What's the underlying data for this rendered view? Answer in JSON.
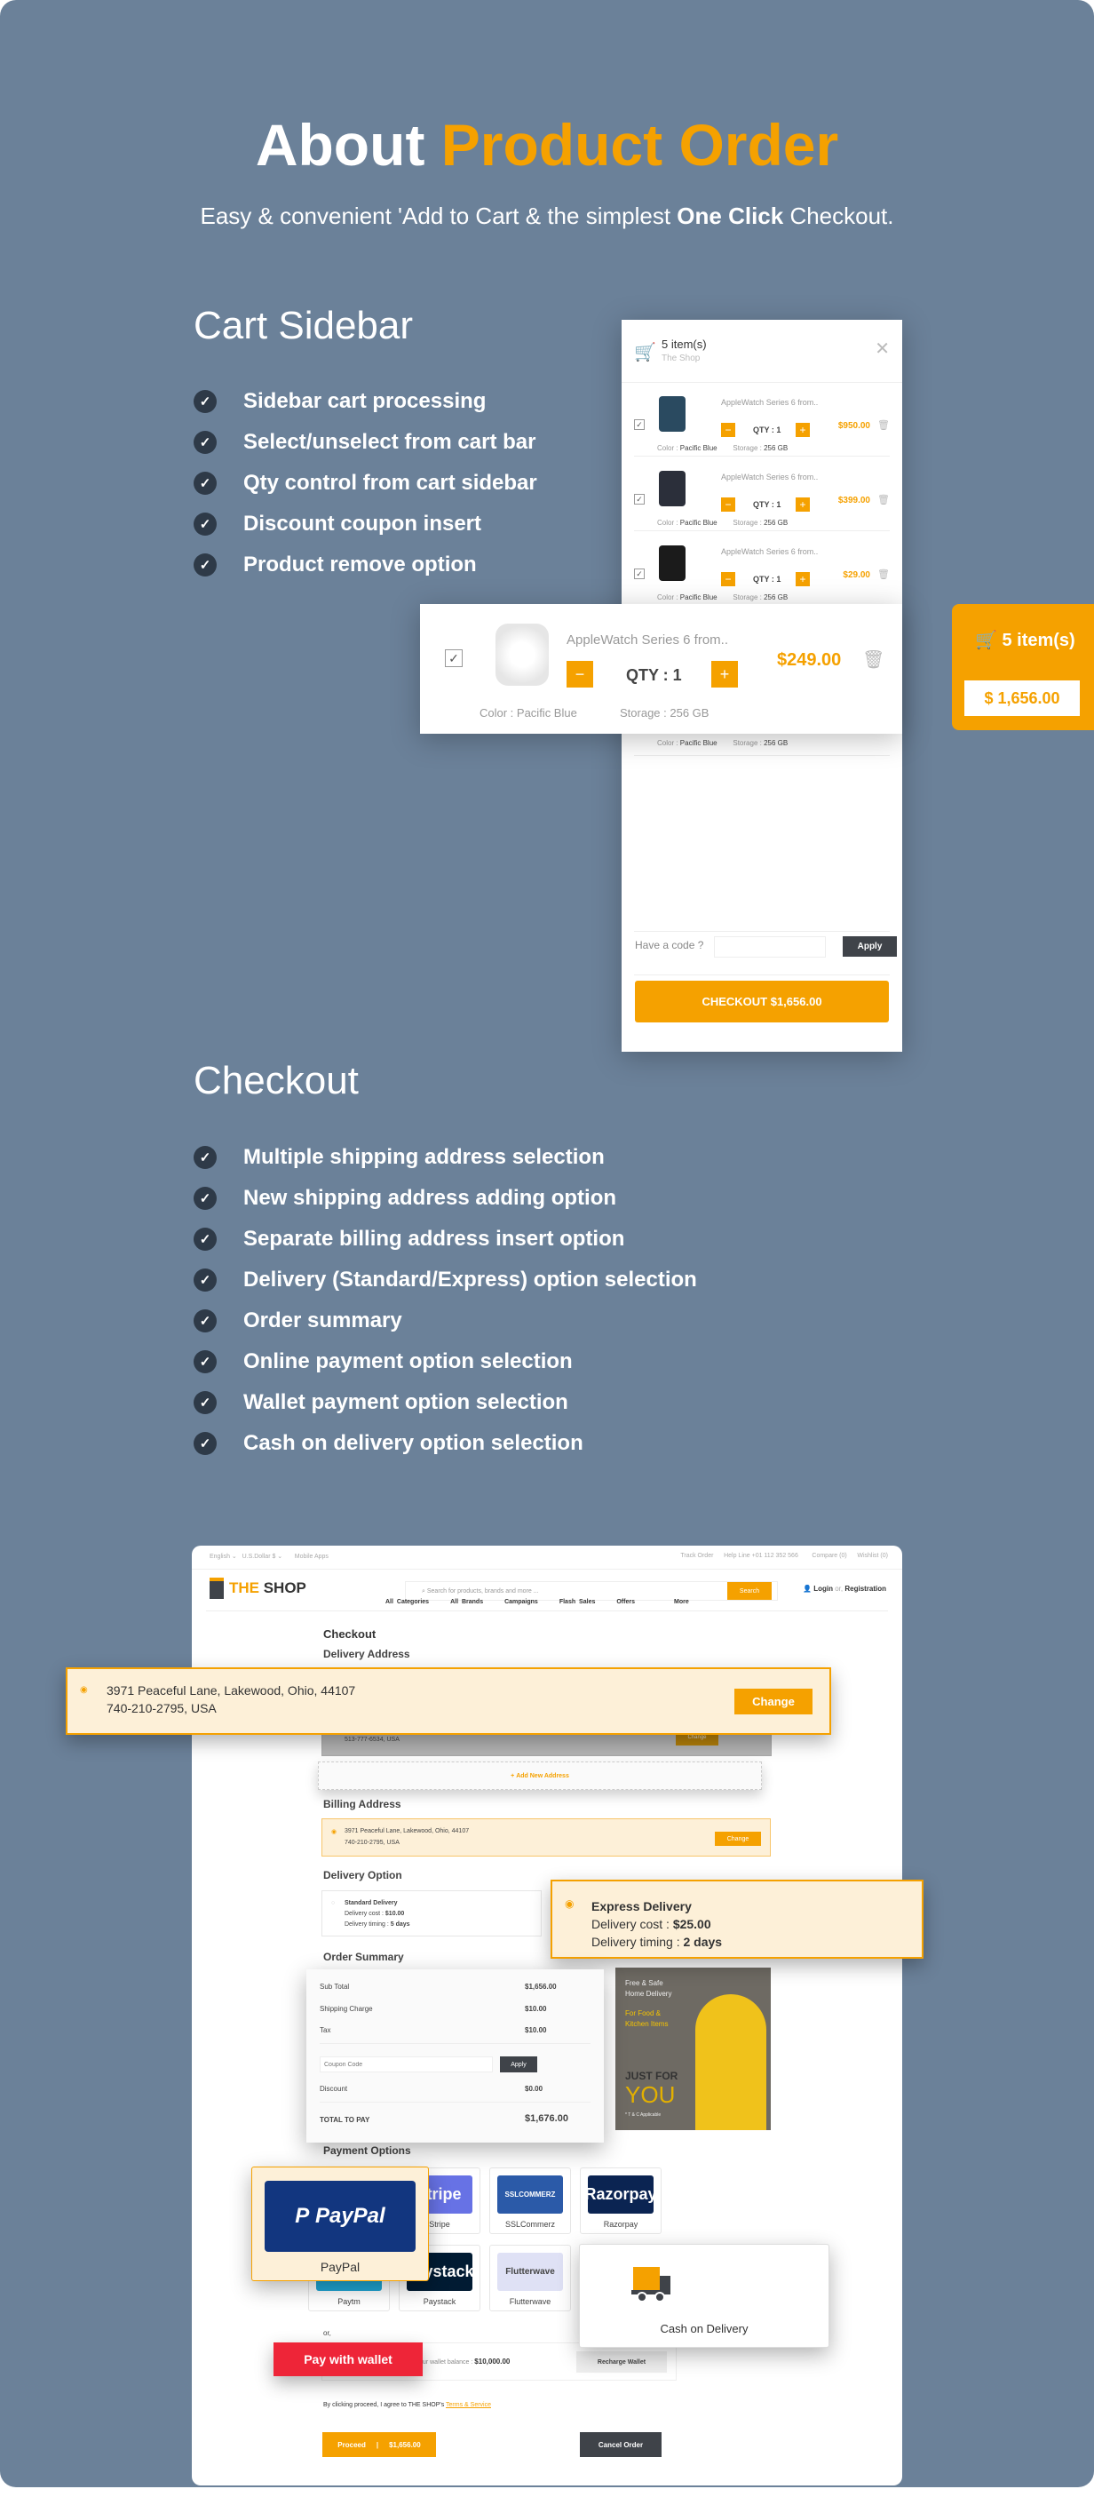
{
  "hero": {
    "title_a": "About",
    "title_b": "Product Order",
    "subtitle_a": "Easy & convenient 'Add to Cart & the simplest ",
    "subtitle_b": "One Click",
    "subtitle_c": " Checkout."
  },
  "cart_section": {
    "title": "Cart Sidebar",
    "features": [
      "Sidebar cart processing",
      "Select/unselect from cart bar",
      "Qty control from cart sidebar",
      "Discount coupon insert",
      "Product remove option"
    ]
  },
  "checkout_section": {
    "title": "Checkout",
    "features": [
      "Multiple shipping address selection",
      "New shipping address adding option",
      "Separate billing address insert option",
      "Delivery (Standard/Express) option selection",
      "Order summary",
      "Online payment option selection",
      "Wallet payment option selection",
      "Cash on delivery option selection"
    ]
  },
  "cart": {
    "count": "5 item(s)",
    "shop": "The Shop",
    "items": [
      {
        "name": "AppleWatch Series 6 from..",
        "qty": "QTY : 1",
        "price": "$950.00",
        "color_label": "Color : ",
        "color": "Pacific Blue",
        "storage_label": "Storage : ",
        "storage": "256 GB"
      },
      {
        "name": "AppleWatch Series 6 from..",
        "qty": "QTY : 1",
        "price": "$399.00",
        "color_label": "Color : ",
        "color": "Pacific Blue",
        "storage_label": "Storage : ",
        "storage": "256 GB"
      },
      {
        "name": "AppleWatch Series 6 from..",
        "qty": "QTY : 1",
        "price": "$29.00",
        "color_label": "Color : ",
        "color": "Pacific Blue",
        "storage_label": "Storage : ",
        "storage": "256 GB"
      },
      {
        "name": "AppleWatch Series 6 from..",
        "qty": "QTY : 1",
        "price": "$249.00",
        "color_label": "Color : ",
        "color": "Pacific Blue",
        "storage_label": "Storage : ",
        "storage": "256 GB"
      }
    ],
    "item4_meta": {
      "color_label": "Color : ",
      "color": "Pacific Blue",
      "storage_label": "Storage : ",
      "storage": "256 GB"
    },
    "coupon_label": "Have a code ?",
    "coupon_value": "",
    "apply": "Apply",
    "checkout": "CHECKOUT  $1,656.00",
    "float_badge": {
      "count": "5 item(s)",
      "total": "$ 1,656.00"
    }
  },
  "shop": {
    "topbar": {
      "lang": "English ⌄",
      "currency": "U.S.Dollar $ ⌄",
      "apps": "Mobile Apps",
      "track": "Track Order",
      "help": "Help Line +01 112 352 566",
      "compare": "Compare (0)",
      "wishlist": "Wishlist (0)"
    },
    "brand_a": "THE",
    "brand_b": " SHOP",
    "search_placeholder": "Search for products, brands and more ...",
    "search_btn": "Search",
    "login": "Login",
    "or": "or,",
    "register": "Registration",
    "nav": [
      "All Categories",
      "All Brands",
      "Campaigns",
      "Flash Sales",
      "Offers",
      "More"
    ],
    "page_title": "Checkout",
    "delivery_address_title": "Delivery Address",
    "selected_address": {
      "line1": "3971  Peaceful Lane, Lakewood, Ohio, 44107",
      "line2": "740-210-2795, USA",
      "change": "Change"
    },
    "other_address": {
      "line2": "513-777-6534, USA",
      "change": "Change"
    },
    "add_address": "Add New Address",
    "billing_title": "Billing Address",
    "billing": {
      "line1": "3971  Peaceful Lane, Lakewood, Ohio, 44107",
      "line2": "740-210-2795, USA",
      "change": "Change"
    },
    "delivery_option_title": "Delivery Option",
    "standard": {
      "name": "Standard Delivery",
      "cost_label": "Delivery cost : ",
      "cost": "$10.00",
      "time_label": "Delivery timing : ",
      "time": "5 days"
    },
    "express": {
      "name": "Express Delivery",
      "cost_label": "Delivery cost : ",
      "cost": "$25.00",
      "time_label": "Delivery timing : ",
      "time": "2 days"
    },
    "order_summary_title": "Order Summary",
    "summary": {
      "subtotal_label": "Sub Total",
      "subtotal": "$1,656.00",
      "shipping_label": "Shipping Charge",
      "shipping": "$10.00",
      "tax_label": "Tax",
      "tax": "$10.00",
      "coupon_placeholder": "Coupon Code",
      "apply": "Apply",
      "discount_label": "Discount",
      "discount": "$0.00",
      "total_label": "TOTAL TO PAY",
      "total": "$1,676.00"
    },
    "banner": {
      "l1": "Free & Safe",
      "l2": "Home Delivery",
      "l3": "For Food &",
      "l4": "Kitchen Items",
      "l5": "JUST FOR",
      "l6": "YOU",
      "l7": "* T & C Applicable"
    },
    "payment_title": "Payment Options",
    "payments": [
      {
        "name": "PayPal",
        "logo": "PayPal",
        "color": "#12367f"
      },
      {
        "name": "Stripe",
        "logo": "stripe",
        "color": "#6772e5"
      },
      {
        "name": "SSLCommerz",
        "logo": "SSLCOMMERZ",
        "color": "#2b5aa8"
      },
      {
        "name": "Razorpay",
        "logo": "Razorpay",
        "color": "#0b2452"
      },
      {
        "name": "Paytm",
        "logo": "Paytm",
        "color": "#1ea5d4"
      },
      {
        "name": "Paystack",
        "logo": "paystack",
        "color": "#011b33"
      },
      {
        "name": "Flutterwave",
        "logo": "Flutterwave",
        "color": "#dfe1f5"
      },
      {
        "name": "Cash on Delivery",
        "logo": "",
        "color": "#f5a100"
      }
    ],
    "wallet": {
      "pay": "Pay with wallet",
      "balance_label": "Your wallet balance : ",
      "balance": "$10,000.00",
      "recharge": "Recharge Wallet"
    },
    "terms_a": "By clicking proceed, I agree to THE SHOP's ",
    "terms_link": "Terms & Service",
    "proceed": "Proceed",
    "proceed_total": "$1,656.00",
    "cancel": "Cancel Order"
  },
  "colors": {
    "accent": "#f5a100",
    "background": "#6b8199",
    "dark": "#3f4349",
    "wallet_red": "#ee2538",
    "selected_bg": "#fdf0d8"
  }
}
